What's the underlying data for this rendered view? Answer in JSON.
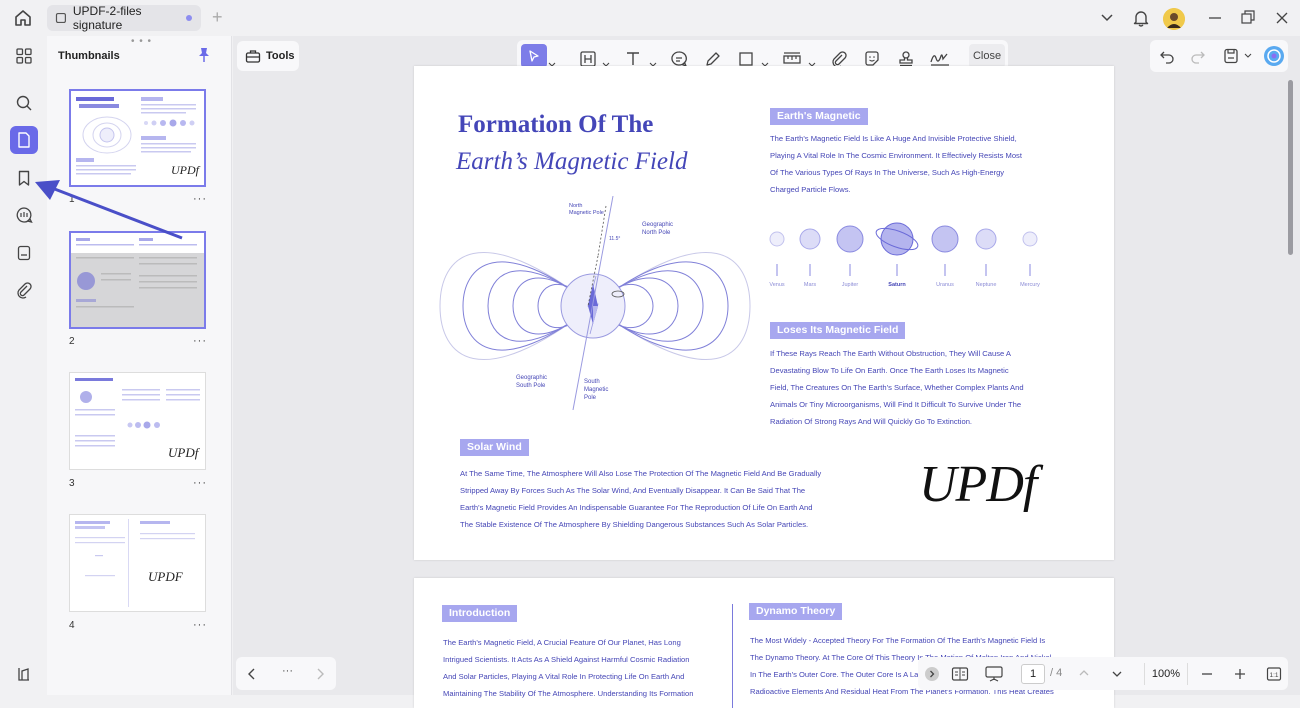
{
  "tab": {
    "title": "UPDF-2-files signature"
  },
  "panel": {
    "title": "Thumbnails",
    "pages": [
      "1",
      "2",
      "3",
      "4"
    ],
    "more": "···"
  },
  "toolbar": {
    "tools_label": "Tools",
    "close_label": "Close"
  },
  "document": {
    "title_line1": "Formation Of The",
    "title_line2": "Earth’s Magnetic Field",
    "diagram_labels": {
      "north_magnetic": [
        "North",
        "Magnetic Pole"
      ],
      "geo_north": [
        "Geographic",
        "North Pole"
      ],
      "geo_south": [
        "Geographic",
        "South Pole"
      ],
      "south_magnetic": [
        "South",
        "Magnetic",
        "Pole"
      ],
      "angle": "11.5°"
    },
    "sections": {
      "earths_magnetic": {
        "heading": "Earth's Magnetic",
        "lines": [
          "The Earth's Magnetic Field Is Like A Huge And Invisible Protective Shield,",
          "Playing A Vital Role In The Cosmic Environment. It Effectively Resists Most",
          "Of The Various Types Of Rays In The Universe, Such As High-Energy",
          "Charged Particle Flows."
        ]
      },
      "loses_field": {
        "heading": "Loses Its Magnetic Field",
        "lines": [
          "If These Rays Reach The Earth Without Obstruction, They Will Cause A",
          "Devastating Blow To Life On Earth. Once The Earth Loses Its Magnetic",
          "Field, The Creatures On The Earth's Surface, Whether Complex Plants And",
          "Animals Or Tiny Microorganisms, Will Find It Difficult To Survive Under The",
          "Radiation Of Strong Rays And Will Quickly Go To Extinction."
        ]
      },
      "solar_wind": {
        "heading": "Solar Wind",
        "lines": [
          "At The Same Time, The Atmosphere Will Also Lose The Protection Of The Magnetic Field And Be Gradually",
          "Stripped Away By Forces Such As The Solar Wind, And Eventually Disappear. It Can Be Said That The",
          "Earth's Magnetic Field Provides An Indispensable Guarantee For The Reproduction Of Life On Earth And",
          "The Stable Existence Of The Atmosphere By Shielding Dangerous Substances Such As Solar Particles."
        ]
      },
      "introduction": {
        "heading": "Introduction",
        "lines": [
          "The Earth's Magnetic Field, A Crucial Feature Of Our Planet, Has Long",
          "Intrigued Scientists. It Acts As A Shield Against Harmful Cosmic Radiation",
          "And Solar Particles, Playing A Vital Role In Protecting Life On Earth And",
          "Maintaining The Stability Of The Atmosphere. Understanding Its Formation"
        ]
      },
      "dynamo": {
        "heading": "Dynamo Theory",
        "lines": [
          "The Most Widely - Accepted Theory For The Formation Of The Earth's Magnetic Field Is",
          "The Dynamo Theory. At The Core Of This Theory Is The Motion Of Molten Iron And Nickel",
          "In The Earth's Outer Core. The Outer Core Is A Layer Of Liquid Metal That Generates",
          "Radioactive Elements And Residual Heat From The Planet's Formation. This Heat Creates"
        ]
      }
    },
    "planets": [
      "Venus",
      "Mars",
      "Jupiter",
      "Saturn",
      "Uranus",
      "Neptune",
      "Mercury"
    ],
    "signature": "UPDf"
  },
  "navigation": {
    "page_current": "1",
    "page_total": "/ 4",
    "zoom": "100%",
    "more": "···"
  }
}
